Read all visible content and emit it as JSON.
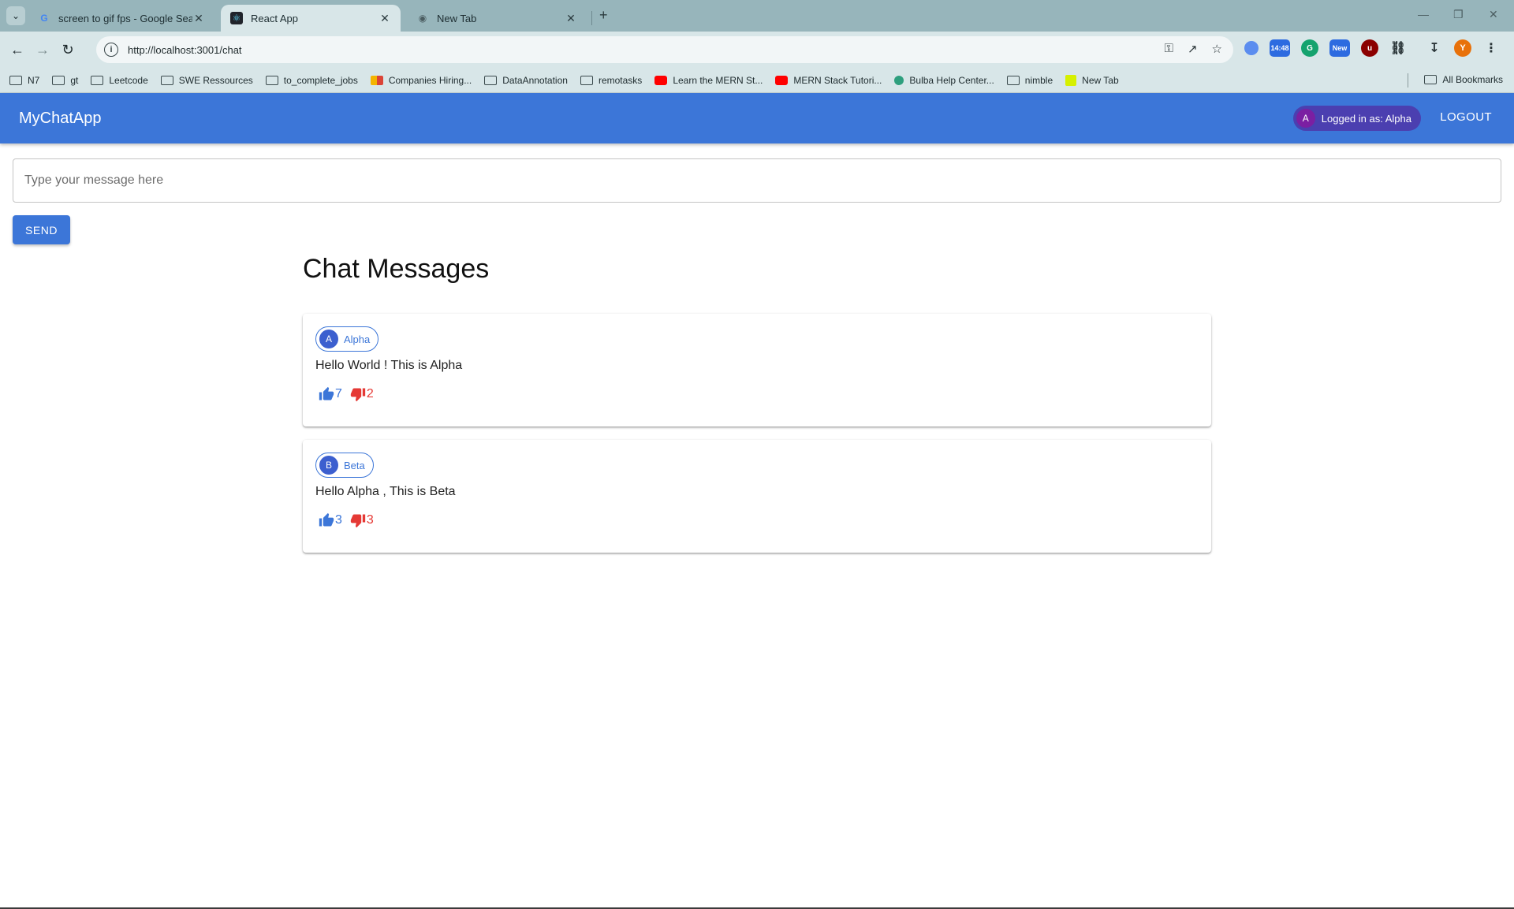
{
  "browser": {
    "tabs": [
      {
        "title": "screen to gif fps - Google Sear",
        "favicon": "google-icon",
        "active": false
      },
      {
        "title": "React App",
        "favicon": "react-icon",
        "active": true
      },
      {
        "title": "New Tab",
        "favicon": "chrome-icon",
        "active": false
      }
    ],
    "url": "http://localhost:3001/chat",
    "bookmarks": [
      {
        "label": "N7",
        "icon": "folder-icon"
      },
      {
        "label": "gt",
        "icon": "folder-icon"
      },
      {
        "label": "Leetcode",
        "icon": "folder-icon"
      },
      {
        "label": "SWE Ressources",
        "icon": "folder-icon"
      },
      {
        "label": "to_complete_jobs",
        "icon": "folder-icon"
      },
      {
        "label": "Companies Hiring...",
        "icon": "site-icon"
      },
      {
        "label": "DataAnnotation",
        "icon": "folder-icon"
      },
      {
        "label": "remotasks",
        "icon": "folder-icon"
      },
      {
        "label": "Learn the MERN St...",
        "icon": "youtube-icon"
      },
      {
        "label": "MERN Stack Tutori...",
        "icon": "youtube-icon"
      },
      {
        "label": "Bulba Help Center...",
        "icon": "site-icon"
      },
      {
        "label": "nimble",
        "icon": "folder-icon"
      },
      {
        "label": "New Tab",
        "icon": "site-icon"
      }
    ],
    "all_bookmarks": "All Bookmarks",
    "extension_badge": "14:48",
    "new_badge": "New",
    "profile_initial": "Y"
  },
  "app": {
    "brand": "MyChatApp",
    "user_initial": "A",
    "logged_in_text": "Logged in as: Alpha",
    "logout_label": "LOGOUT",
    "composer_placeholder": "Type your message here",
    "send_label": "SEND",
    "chat_title": "Chat Messages",
    "accent_color": "#3c76d8"
  },
  "messages": [
    {
      "author_initial": "A",
      "author": "Alpha",
      "text": "Hello World ! This is Alpha",
      "likes": "7",
      "dislikes": "2"
    },
    {
      "author_initial": "B",
      "author": "Beta",
      "text": "Hello Alpha , This is Beta",
      "likes": "3",
      "dislikes": "3"
    }
  ]
}
